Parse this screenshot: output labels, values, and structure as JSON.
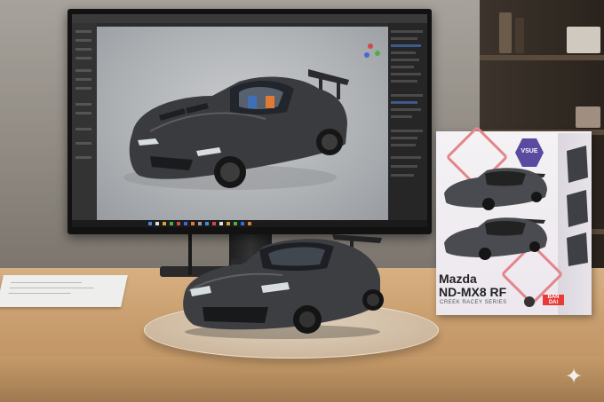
{
  "scene": {
    "description_alt": "",
    "colors": {
      "wall": "#9a958e",
      "desk": "#c99e6e",
      "car_body": "#3c3d40",
      "viewport": "#b9bcbf",
      "box_accent": "#e2868a",
      "box_badge": "#5a4aa0",
      "brand_red": "#e83a37"
    }
  },
  "product_box": {
    "badge_text": "VSUE",
    "title_line1": "Mazda",
    "title_line2": "ND-MX8 RF",
    "subtitle": "CREEK RACEY SERIES",
    "brand": "BAN DAI"
  },
  "icons": [
    "sparkle-icon"
  ]
}
